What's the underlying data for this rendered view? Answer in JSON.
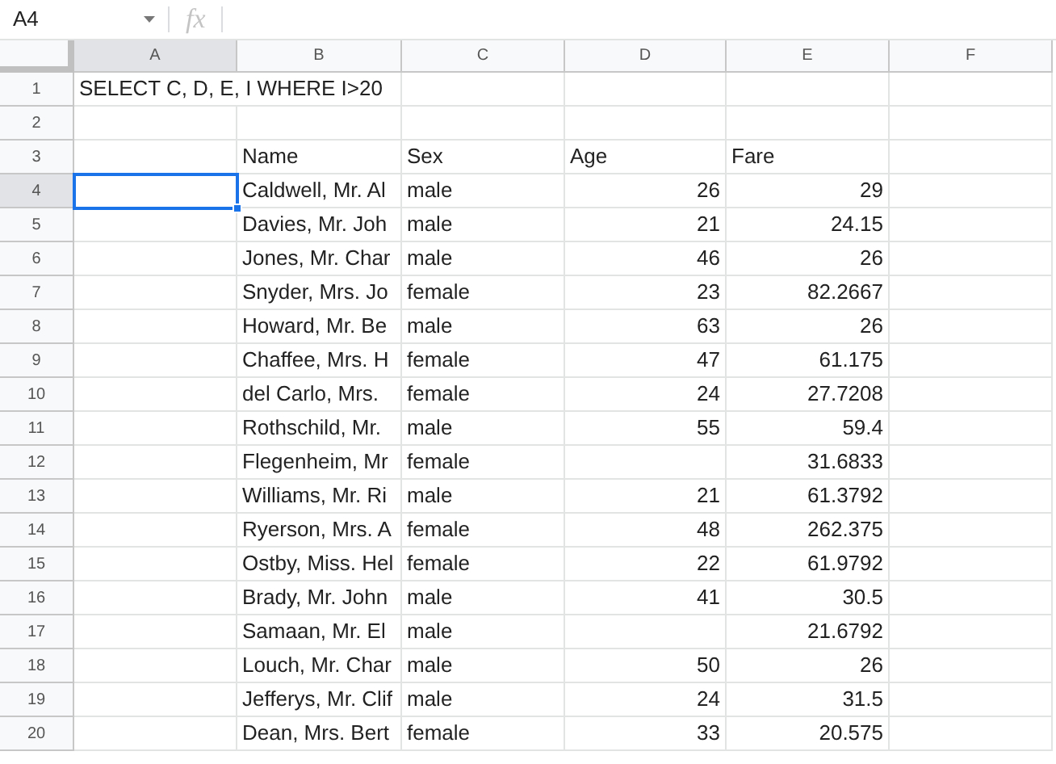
{
  "name_box": {
    "value": "A4"
  },
  "formula_bar": {
    "icon": "fx"
  },
  "columns": [
    {
      "label": "A",
      "selected": true
    },
    {
      "label": "B",
      "selected": false
    },
    {
      "label": "C",
      "selected": false
    },
    {
      "label": "D",
      "selected": false
    },
    {
      "label": "E",
      "selected": false
    },
    {
      "label": "F",
      "selected": false
    }
  ],
  "rows": [
    {
      "number": "1",
      "selected": false,
      "cells": [
        {
          "kind": "wide",
          "text": "SELECT C, D, E, I WHERE I>20",
          "selected": false
        },
        {
          "kind": "empty",
          "selected": false
        },
        {
          "kind": "empty",
          "selected": false
        },
        {
          "kind": "empty",
          "selected": false
        },
        {
          "kind": "empty",
          "selected": false
        }
      ]
    },
    {
      "number": "2",
      "selected": false,
      "cells": [
        {
          "kind": "empty",
          "selected": false
        },
        {
          "kind": "empty",
          "selected": false
        },
        {
          "kind": "empty",
          "selected": false
        },
        {
          "kind": "empty",
          "selected": false
        },
        {
          "kind": "empty",
          "selected": false
        },
        {
          "kind": "empty",
          "selected": false
        }
      ]
    },
    {
      "number": "3",
      "selected": false,
      "cells": [
        {
          "kind": "empty",
          "selected": false
        },
        {
          "kind": "text",
          "text": "Name",
          "selected": false
        },
        {
          "kind": "text",
          "text": "Sex",
          "selected": false
        },
        {
          "kind": "text",
          "text": "Age",
          "selected": false
        },
        {
          "kind": "text",
          "text": "Fare",
          "selected": false
        },
        {
          "kind": "empty",
          "selected": false
        }
      ]
    },
    {
      "number": "4",
      "selected": true,
      "cells": [
        {
          "kind": "empty",
          "selected": true
        },
        {
          "kind": "text",
          "text": "Caldwell, Mr. Al",
          "selected": false
        },
        {
          "kind": "text",
          "text": "male",
          "selected": false
        },
        {
          "kind": "number",
          "text": "26",
          "selected": false
        },
        {
          "kind": "number",
          "text": "29",
          "selected": false
        },
        {
          "kind": "empty",
          "selected": false
        }
      ]
    },
    {
      "number": "5",
      "selected": false,
      "cells": [
        {
          "kind": "empty",
          "selected": false
        },
        {
          "kind": "text",
          "text": "Davies, Mr. Joh",
          "selected": false
        },
        {
          "kind": "text",
          "text": "male",
          "selected": false
        },
        {
          "kind": "number",
          "text": "21",
          "selected": false
        },
        {
          "kind": "number",
          "text": "24.15",
          "selected": false
        },
        {
          "kind": "empty",
          "selected": false
        }
      ]
    },
    {
      "number": "6",
      "selected": false,
      "cells": [
        {
          "kind": "empty",
          "selected": false
        },
        {
          "kind": "text",
          "text": "Jones, Mr. Char",
          "selected": false
        },
        {
          "kind": "text",
          "text": "male",
          "selected": false
        },
        {
          "kind": "number",
          "text": "46",
          "selected": false
        },
        {
          "kind": "number",
          "text": "26",
          "selected": false
        },
        {
          "kind": "empty",
          "selected": false
        }
      ]
    },
    {
      "number": "7",
      "selected": false,
      "cells": [
        {
          "kind": "empty",
          "selected": false
        },
        {
          "kind": "text",
          "text": "Snyder, Mrs. Jo",
          "selected": false
        },
        {
          "kind": "text",
          "text": "female",
          "selected": false
        },
        {
          "kind": "number",
          "text": "23",
          "selected": false
        },
        {
          "kind": "number",
          "text": "82.2667",
          "selected": false
        },
        {
          "kind": "empty",
          "selected": false
        }
      ]
    },
    {
      "number": "8",
      "selected": false,
      "cells": [
        {
          "kind": "empty",
          "selected": false
        },
        {
          "kind": "text",
          "text": "Howard, Mr. Be",
          "selected": false
        },
        {
          "kind": "text",
          "text": "male",
          "selected": false
        },
        {
          "kind": "number",
          "text": "63",
          "selected": false
        },
        {
          "kind": "number",
          "text": "26",
          "selected": false
        },
        {
          "kind": "empty",
          "selected": false
        }
      ]
    },
    {
      "number": "9",
      "selected": false,
      "cells": [
        {
          "kind": "empty",
          "selected": false
        },
        {
          "kind": "text",
          "text": "Chaffee, Mrs. H",
          "selected": false
        },
        {
          "kind": "text",
          "text": "female",
          "selected": false
        },
        {
          "kind": "number",
          "text": "47",
          "selected": false
        },
        {
          "kind": "number",
          "text": "61.175",
          "selected": false
        },
        {
          "kind": "empty",
          "selected": false
        }
      ]
    },
    {
      "number": "10",
      "selected": false,
      "cells": [
        {
          "kind": "empty",
          "selected": false
        },
        {
          "kind": "text",
          "text": "del Carlo, Mrs.",
          "selected": false
        },
        {
          "kind": "text",
          "text": "female",
          "selected": false
        },
        {
          "kind": "number",
          "text": "24",
          "selected": false
        },
        {
          "kind": "number",
          "text": "27.7208",
          "selected": false
        },
        {
          "kind": "empty",
          "selected": false
        }
      ]
    },
    {
      "number": "11",
      "selected": false,
      "cells": [
        {
          "kind": "empty",
          "selected": false
        },
        {
          "kind": "text",
          "text": "Rothschild, Mr.",
          "selected": false
        },
        {
          "kind": "text",
          "text": "male",
          "selected": false
        },
        {
          "kind": "number",
          "text": "55",
          "selected": false
        },
        {
          "kind": "number",
          "text": "59.4",
          "selected": false
        },
        {
          "kind": "empty",
          "selected": false
        }
      ]
    },
    {
      "number": "12",
      "selected": false,
      "cells": [
        {
          "kind": "empty",
          "selected": false
        },
        {
          "kind": "text",
          "text": "Flegenheim, Mr",
          "selected": false
        },
        {
          "kind": "text",
          "text": "female",
          "selected": false
        },
        {
          "kind": "empty",
          "selected": false
        },
        {
          "kind": "number",
          "text": "31.6833",
          "selected": false
        },
        {
          "kind": "empty",
          "selected": false
        }
      ]
    },
    {
      "number": "13",
      "selected": false,
      "cells": [
        {
          "kind": "empty",
          "selected": false
        },
        {
          "kind": "text",
          "text": "Williams, Mr. Ri",
          "selected": false
        },
        {
          "kind": "text",
          "text": "male",
          "selected": false
        },
        {
          "kind": "number",
          "text": "21",
          "selected": false
        },
        {
          "kind": "number",
          "text": "61.3792",
          "selected": false
        },
        {
          "kind": "empty",
          "selected": false
        }
      ]
    },
    {
      "number": "14",
      "selected": false,
      "cells": [
        {
          "kind": "empty",
          "selected": false
        },
        {
          "kind": "text",
          "text": "Ryerson, Mrs. A",
          "selected": false
        },
        {
          "kind": "text",
          "text": "female",
          "selected": false
        },
        {
          "kind": "number",
          "text": "48",
          "selected": false
        },
        {
          "kind": "number",
          "text": "262.375",
          "selected": false
        },
        {
          "kind": "empty",
          "selected": false
        }
      ]
    },
    {
      "number": "15",
      "selected": false,
      "cells": [
        {
          "kind": "empty",
          "selected": false
        },
        {
          "kind": "text",
          "text": "Ostby, Miss. Hel",
          "selected": false
        },
        {
          "kind": "text",
          "text": "female",
          "selected": false
        },
        {
          "kind": "number",
          "text": "22",
          "selected": false
        },
        {
          "kind": "number",
          "text": "61.9792",
          "selected": false
        },
        {
          "kind": "empty",
          "selected": false
        }
      ]
    },
    {
      "number": "16",
      "selected": false,
      "cells": [
        {
          "kind": "empty",
          "selected": false
        },
        {
          "kind": "text",
          "text": "Brady, Mr. John",
          "selected": false
        },
        {
          "kind": "text",
          "text": "male",
          "selected": false
        },
        {
          "kind": "number",
          "text": "41",
          "selected": false
        },
        {
          "kind": "number",
          "text": "30.5",
          "selected": false
        },
        {
          "kind": "empty",
          "selected": false
        }
      ]
    },
    {
      "number": "17",
      "selected": false,
      "cells": [
        {
          "kind": "empty",
          "selected": false
        },
        {
          "kind": "text",
          "text": "Samaan, Mr. El",
          "selected": false
        },
        {
          "kind": "text",
          "text": "male",
          "selected": false
        },
        {
          "kind": "empty",
          "selected": false
        },
        {
          "kind": "number",
          "text": "21.6792",
          "selected": false
        },
        {
          "kind": "empty",
          "selected": false
        }
      ]
    },
    {
      "number": "18",
      "selected": false,
      "cells": [
        {
          "kind": "empty",
          "selected": false
        },
        {
          "kind": "text",
          "text": "Louch, Mr. Char",
          "selected": false
        },
        {
          "kind": "text",
          "text": "male",
          "selected": false
        },
        {
          "kind": "number",
          "text": "50",
          "selected": false
        },
        {
          "kind": "number",
          "text": "26",
          "selected": false
        },
        {
          "kind": "empty",
          "selected": false
        }
      ]
    },
    {
      "number": "19",
      "selected": false,
      "cells": [
        {
          "kind": "empty",
          "selected": false
        },
        {
          "kind": "text",
          "text": "Jefferys, Mr. Clif",
          "selected": false
        },
        {
          "kind": "text",
          "text": "male",
          "selected": false
        },
        {
          "kind": "number",
          "text": "24",
          "selected": false
        },
        {
          "kind": "number",
          "text": "31.5",
          "selected": false
        },
        {
          "kind": "empty",
          "selected": false
        }
      ]
    },
    {
      "number": "20",
      "selected": false,
      "cells": [
        {
          "kind": "empty",
          "selected": false
        },
        {
          "kind": "text",
          "text": "Dean, Mrs. Bert",
          "selected": false
        },
        {
          "kind": "text",
          "text": "female",
          "selected": false
        },
        {
          "kind": "number",
          "text": "33",
          "selected": false
        },
        {
          "kind": "number",
          "text": "20.575",
          "selected": false
        },
        {
          "kind": "empty",
          "selected": false
        }
      ]
    }
  ]
}
